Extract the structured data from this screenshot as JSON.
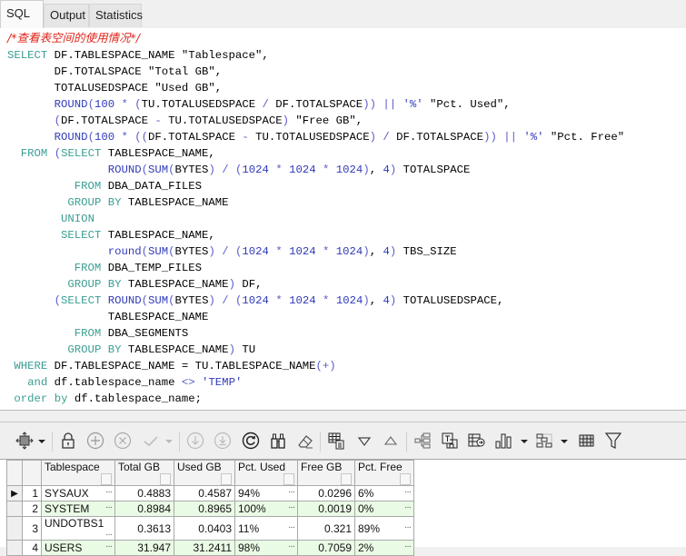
{
  "tabs": [
    {
      "label": "SQL",
      "active": true
    },
    {
      "label": "Output",
      "active": false
    },
    {
      "label": "Statistics",
      "active": false
    }
  ],
  "editor": {
    "comment": "/*查看表空间的使用情况*/",
    "lines": [
      "SELECT DF.TABLESPACE_NAME \"Tablespace\",",
      "       DF.TOTALSPACE \"Total GB\",",
      "       TOTALUSEDSPACE \"Used GB\",",
      "       ROUND(100 * (TU.TOTALUSEDSPACE / DF.TOTALSPACE)) || '%' \"Pct. Used\",",
      "       (DF.TOTALSPACE - TU.TOTALUSEDSPACE) \"Free GB\",",
      "       ROUND(100 * ((DF.TOTALSPACE - TU.TOTALUSEDSPACE) / DF.TOTALSPACE)) || '%' \"Pct. Free\"",
      "  FROM (SELECT TABLESPACE_NAME,",
      "               ROUND(SUM(BYTES) / (1024 * 1024 * 1024), 4) TOTALSPACE",
      "          FROM DBA_DATA_FILES",
      "         GROUP BY TABLESPACE_NAME",
      "        UNION",
      "        SELECT TABLESPACE_NAME,",
      "               round(SUM(BYTES) / (1024 * 1024 * 1024), 4) TBS_SIZE",
      "          FROM DBA_TEMP_FILES",
      "         GROUP BY TABLESPACE_NAME) DF,",
      "       (SELECT ROUND(SUM(BYTES) / (1024 * 1024 * 1024), 4) TOTALUSEDSPACE,",
      "               TABLESPACE_NAME",
      "          FROM DBA_SEGMENTS",
      "         GROUP BY TABLESPACE_NAME) TU",
      " WHERE DF.TABLESPACE_NAME = TU.TABLESPACE_NAME(+)",
      "   and df.tablespace_name <> 'TEMP'",
      " order by df.tablespace_name;"
    ]
  },
  "toolbar": {
    "icons": [
      "select-mode-icon",
      "lock-icon",
      "add-record-icon",
      "delete-record-icon",
      "post-edit-icon",
      "move-down-icon",
      "move-last-icon",
      "refresh-icon",
      "find-icon",
      "clear-icon",
      "grid-options-icon",
      "sort-descending-icon",
      "sort-ascending-icon",
      "tree-view-icon",
      "export-text-icon",
      "export-data-icon",
      "chart-icon",
      "layout-icon",
      "table-view-icon",
      "filter-icon"
    ]
  },
  "grid": {
    "columns": [
      "Tablespace",
      "Total GB",
      "Used GB",
      "Pct. Used",
      "Free GB",
      "Pct. Free"
    ],
    "rows": [
      {
        "n": "1",
        "tablespace": "SYSAUX",
        "total": "0.4883",
        "used": "0.4587",
        "pct_used": "94%",
        "free": "0.0296",
        "pct_free": "6%"
      },
      {
        "n": "2",
        "tablespace": "SYSTEM",
        "total": "0.8984",
        "used": "0.8965",
        "pct_used": "100%",
        "free": "0.0019",
        "pct_free": "0%"
      },
      {
        "n": "3",
        "tablespace": "UNDOTBS1",
        "total": "0.3613",
        "used": "0.0403",
        "pct_used": "11%",
        "free": "0.321",
        "pct_free": "89%"
      },
      {
        "n": "4",
        "tablespace": "USERS",
        "total": "31.947",
        "used": "31.2411",
        "pct_used": "98%",
        "free": "0.7059",
        "pct_free": "2%"
      }
    ],
    "current_row": 1,
    "ellipsis": "···"
  }
}
